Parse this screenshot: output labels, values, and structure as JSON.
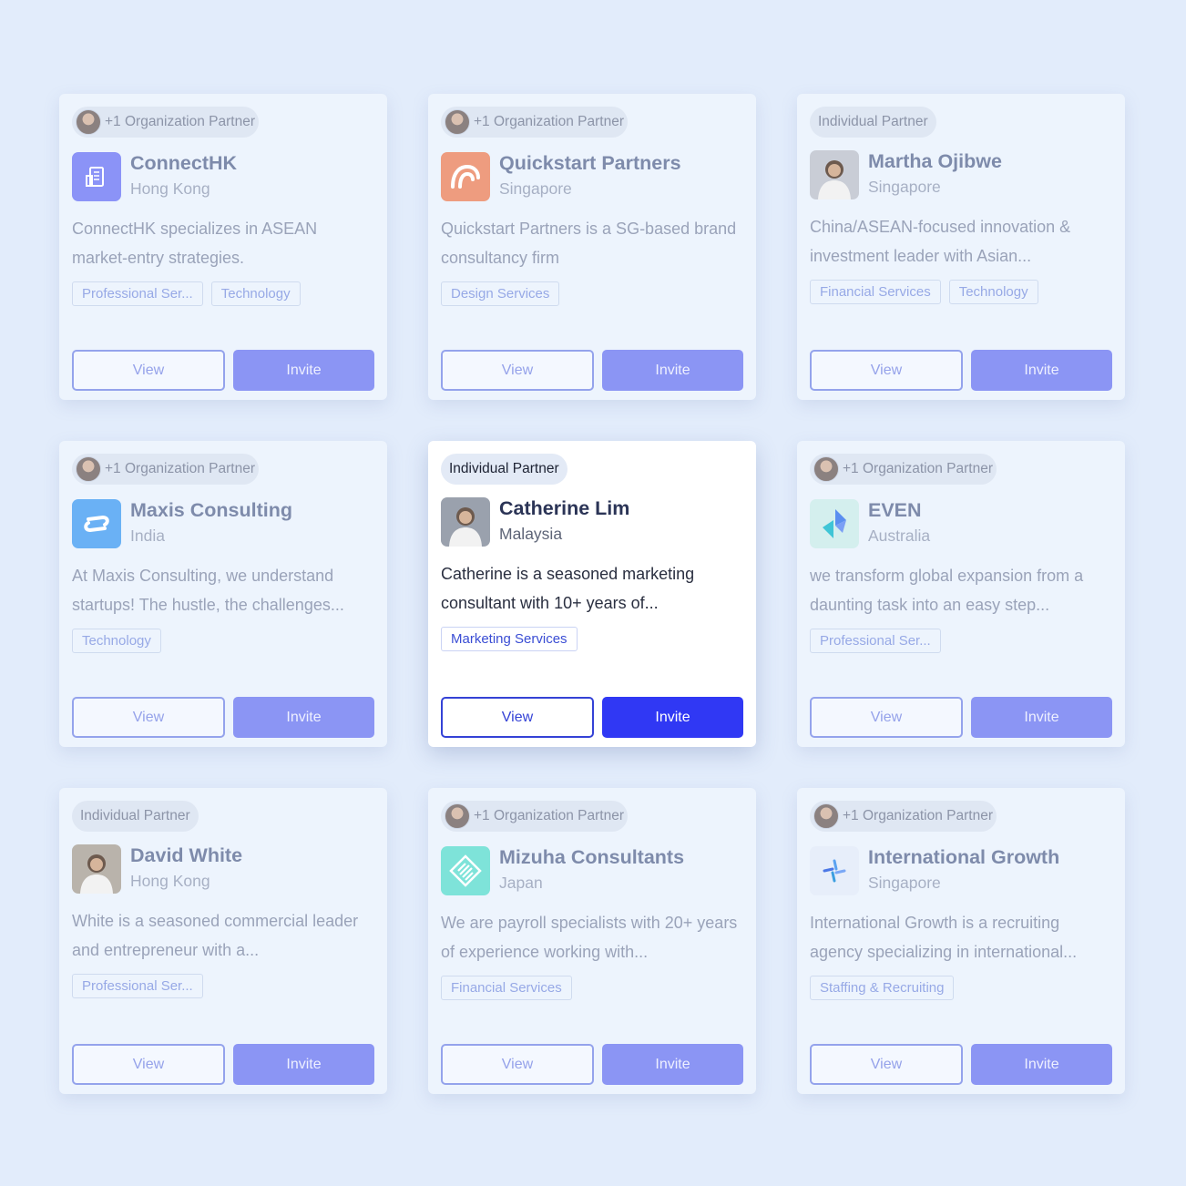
{
  "cards": [
    {
      "badge": "+1 Organization Partner",
      "badge_avatar": true,
      "name": "ConnectHK",
      "location": "Hong Kong",
      "description": "ConnectHK specializes in ASEAN market-entry strategies.",
      "tags": [
        "Professional Ser...",
        "Technology"
      ],
      "logo": "building-icon",
      "logo_color": "#8b93f7",
      "view_label": "View",
      "invite_label": "Invite"
    },
    {
      "badge": "+1 Organization Partner",
      "badge_avatar": true,
      "name": "Quickstart Partners",
      "location": "Singapore",
      "description": "Quickstart Partners is a SG-based brand consultancy firm",
      "tags": [
        "Design Services"
      ],
      "logo": "quickstart-logo-icon",
      "logo_color": "#ee9c7f",
      "view_label": "View",
      "invite_label": "Invite"
    },
    {
      "badge": "Individual Partner",
      "badge_avatar": false,
      "name": "Martha Ojibwe",
      "location": "Singapore",
      "description": "China/ASEAN-focused innovation & investment leader with Asian...",
      "tags": [
        "Financial Services",
        "Technology"
      ],
      "logo": "person-photo-icon",
      "logo_color": "#c9cdd6",
      "view_label": "View",
      "invite_label": "Invite"
    },
    {
      "badge": "+1 Organization Partner",
      "badge_avatar": true,
      "name": "Maxis Consulting",
      "location": "India",
      "description": "At Maxis Consulting, we understand startups! The hustle, the challenges...",
      "tags": [
        "Technology"
      ],
      "logo": "maxis-logo-icon",
      "logo_color": "#6ab1f5",
      "view_label": "View",
      "invite_label": "Invite"
    },
    {
      "badge": "Individual Partner",
      "badge_avatar": false,
      "name": "Catherine Lim",
      "location": "Malaysia",
      "description": "Catherine is a seasoned marketing consultant with 10+ years of...",
      "tags": [
        "Marketing Services"
      ],
      "logo": "person-photo-icon",
      "logo_color": "#9aa1ad",
      "view_label": "View",
      "invite_label": "Invite",
      "active": true
    },
    {
      "badge": "+1 Organization Partner",
      "badge_avatar": true,
      "name": "EVEN",
      "location": "Australia",
      "description": "we transform global expansion from a daunting task into an easy step...",
      "tags": [
        "Professional Ser..."
      ],
      "logo": "even-logo-icon",
      "logo_color": "#d4efee",
      "view_label": "View",
      "invite_label": "Invite"
    },
    {
      "badge": "Individual Partner",
      "badge_avatar": false,
      "name": "David White",
      "location": "Hong Kong",
      "description": "White is a seasoned commercial leader and entrepreneur with a...",
      "tags": [
        "Professional Ser..."
      ],
      "logo": "person-photo-icon",
      "logo_color": "#b9b3ab",
      "view_label": "View",
      "invite_label": "Invite"
    },
    {
      "badge": "+1 Organization Partner",
      "badge_avatar": true,
      "name": "Mizuha Consultants",
      "location": "Japan",
      "description": "We are payroll specialists with 20+ years of experience working with...",
      "tags": [
        "Financial Services"
      ],
      "logo": "mizuha-logo-icon",
      "logo_color": "#7ee3d9",
      "view_label": "View",
      "invite_label": "Invite"
    },
    {
      "badge": "+1 Organization Partner",
      "badge_avatar": true,
      "name": "International Growth",
      "location": "Singapore",
      "description": "International Growth is a recruiting agency specializing in international...",
      "tags": [
        "Staffing & Recruiting"
      ],
      "logo": "growth-logo-icon",
      "logo_color": "#e7eefa",
      "view_label": "View",
      "invite_label": "Invite"
    }
  ]
}
